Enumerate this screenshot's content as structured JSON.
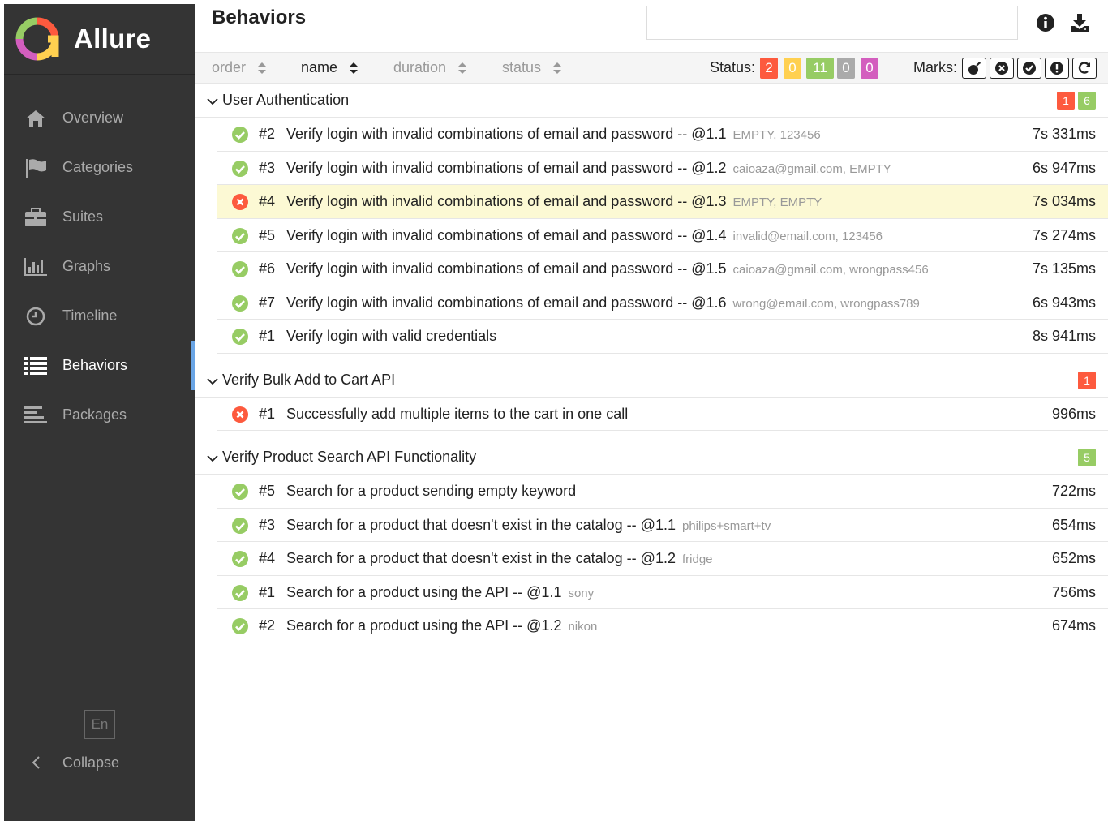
{
  "app": {
    "name": "Allure"
  },
  "sidebar": {
    "items": [
      {
        "label": "Overview",
        "icon": "home-icon"
      },
      {
        "label": "Categories",
        "icon": "flag-icon"
      },
      {
        "label": "Suites",
        "icon": "briefcase-icon"
      },
      {
        "label": "Graphs",
        "icon": "bar-chart-icon"
      },
      {
        "label": "Timeline",
        "icon": "clock-icon"
      },
      {
        "label": "Behaviors",
        "icon": "list-icon",
        "active": true
      },
      {
        "label": "Packages",
        "icon": "align-left-icon"
      }
    ],
    "lang": "En",
    "collapse": "Collapse"
  },
  "header": {
    "title": "Behaviors",
    "search_value": ""
  },
  "sortbar": {
    "order": "order",
    "name": "name",
    "duration": "duration",
    "status": "status",
    "status_label": "Status:",
    "status_counts": [
      {
        "value": "2",
        "color": "#fd5a3e",
        "kind": "failed"
      },
      {
        "value": "0",
        "color": "#ffd050",
        "kind": "broken"
      },
      {
        "value": "11",
        "color": "#97cc64",
        "kind": "passed"
      },
      {
        "value": "0",
        "color": "#aaaaaa",
        "kind": "skipped"
      },
      {
        "value": "0",
        "color": "#d35ebe",
        "kind": "unknown"
      }
    ],
    "marks_label": "Marks:",
    "marks": [
      "bomb-icon",
      "x-circle-icon",
      "check-circle-icon",
      "exclamation-circle-icon",
      "refresh-icon"
    ]
  },
  "groups": [
    {
      "name": "User Authentication",
      "badges": [
        {
          "value": "1",
          "color": "#fd5a3e"
        },
        {
          "value": "6",
          "color": "#97cc64"
        }
      ],
      "rows": [
        {
          "status": "passed",
          "num": "#2",
          "name": "Verify login with invalid combinations of email and password -- @1.1",
          "params": "EMPTY, 123456",
          "duration": "7s 331ms"
        },
        {
          "status": "passed",
          "num": "#3",
          "name": "Verify login with invalid combinations of email and password -- @1.2",
          "params": "caioaza@gmail.com, EMPTY",
          "duration": "6s 947ms"
        },
        {
          "status": "failed",
          "num": "#4",
          "name": "Verify login with invalid combinations of email and password -- @1.3",
          "params": "EMPTY, EMPTY",
          "duration": "7s 034ms",
          "highlight": true
        },
        {
          "status": "passed",
          "num": "#5",
          "name": "Verify login with invalid combinations of email and password -- @1.4",
          "params": "invalid@email.com, 123456",
          "duration": "7s 274ms"
        },
        {
          "status": "passed",
          "num": "#6",
          "name": "Verify login with invalid combinations of email and password -- @1.5",
          "params": "caioaza@gmail.com, wrongpass456",
          "duration": "7s 135ms"
        },
        {
          "status": "passed",
          "num": "#7",
          "name": "Verify login with invalid combinations of email and password -- @1.6",
          "params": "wrong@email.com, wrongpass789",
          "duration": "6s 943ms"
        },
        {
          "status": "passed",
          "num": "#1",
          "name": "Verify login with valid credentials",
          "params": "",
          "duration": "8s 941ms"
        }
      ]
    },
    {
      "name": "Verify Bulk Add to Cart API",
      "badges": [
        {
          "value": "1",
          "color": "#fd5a3e"
        }
      ],
      "rows": [
        {
          "status": "failed",
          "num": "#1",
          "name": "Successfully add multiple items to the cart in one call",
          "params": "",
          "duration": "996ms"
        }
      ]
    },
    {
      "name": "Verify Product Search API Functionality",
      "badges": [
        {
          "value": "5",
          "color": "#97cc64"
        }
      ],
      "rows": [
        {
          "status": "passed",
          "num": "#5",
          "name": "Search for a product sending empty keyword",
          "params": "",
          "duration": "722ms"
        },
        {
          "status": "passed",
          "num": "#3",
          "name": "Search for a product that doesn't exist in the catalog -- @1.1",
          "params": "philips+smart+tv",
          "duration": "654ms"
        },
        {
          "status": "passed",
          "num": "#4",
          "name": "Search for a product that doesn't exist in the catalog -- @1.2",
          "params": "fridge",
          "duration": "652ms"
        },
        {
          "status": "passed",
          "num": "#1",
          "name": "Search for a product using the API -- @1.1",
          "params": "sony",
          "duration": "756ms"
        },
        {
          "status": "passed",
          "num": "#2",
          "name": "Search for a product using the API -- @1.2",
          "params": "nikon",
          "duration": "674ms"
        }
      ]
    }
  ]
}
